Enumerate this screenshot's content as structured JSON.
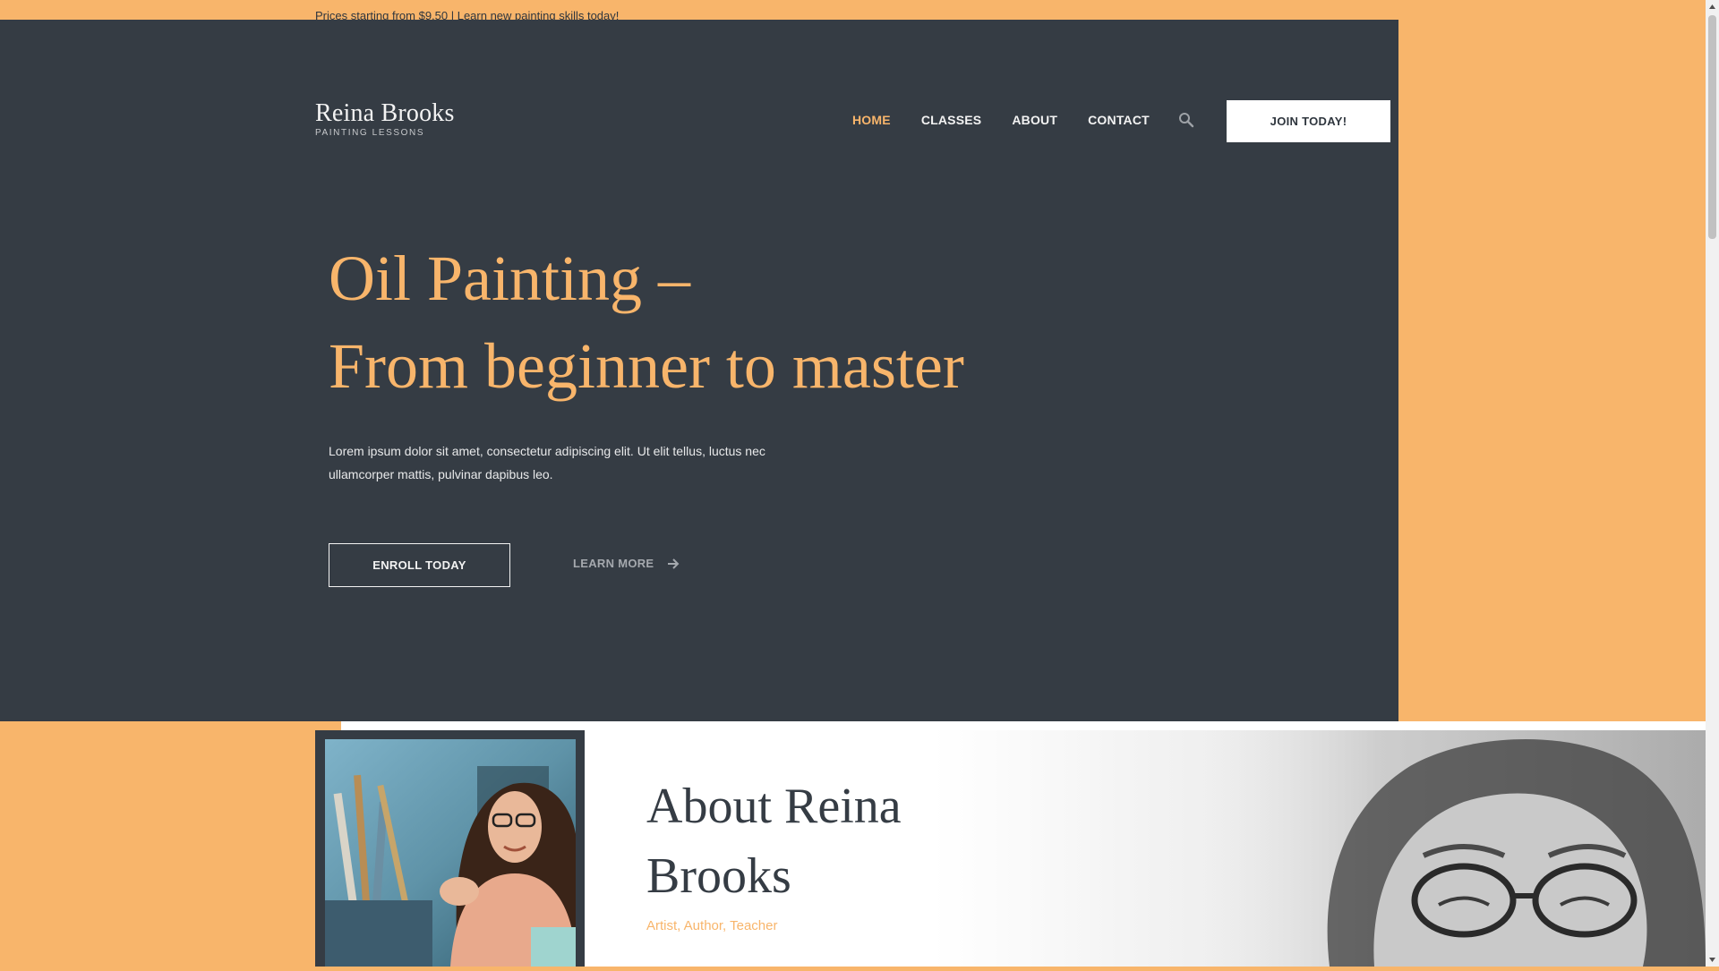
{
  "topbar": {
    "text": "Prices starting from $9,50 | Learn new painting skills today!"
  },
  "header": {
    "logo_name": "Reina Brooks",
    "logo_sub": "PAINTING LESSONS",
    "nav": [
      "HOME",
      "CLASSES",
      "ABOUT",
      "CONTACT"
    ],
    "active_nav": "HOME",
    "search_icon": "search-icon",
    "join_label": "JOIN TODAY!"
  },
  "hero": {
    "title_line1": "Oil Painting –",
    "title_line2": "From beginner to master",
    "text": "Lorem ipsum dolor sit amet, consectetur adipiscing elit. Ut elit tellus, luctus nec ullamcorper mattis, pulvinar dapibus leo.",
    "enroll_label": "ENROLL TODAY",
    "learn_label": "LEARN MORE",
    "learn_icon": "arrow-right-icon"
  },
  "about": {
    "title": "About Reina Brooks",
    "subtitle": "Artist, Author, Teacher"
  },
  "colors": {
    "accent": "#f8b56b",
    "dark": "#353c44",
    "light": "#f3f3f3"
  }
}
